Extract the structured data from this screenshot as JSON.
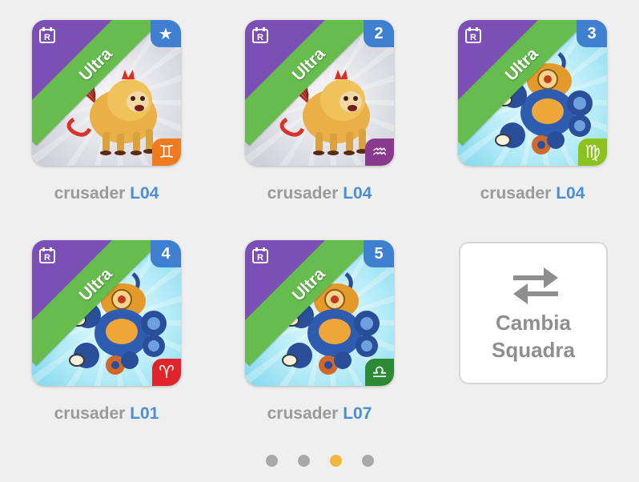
{
  "cards": [
    {
      "tier_label": "Ultra",
      "badge_top": "★",
      "badge_top_icon": "star-icon",
      "badge_bottom": "♊",
      "badge_bottom_icon": "gemini-sign-icon",
      "badge_bottom_color": "#f07a1e",
      "bg": "gray",
      "creature": "lion-monkey-creature",
      "name": "crusader",
      "level": "L04"
    },
    {
      "tier_label": "Ultra",
      "badge_top": "2",
      "badge_bottom": "♒",
      "badge_bottom_icon": "aquarius-sign-icon",
      "badge_bottom_color": "#8a3a8e",
      "bg": "gray",
      "creature": "lion-monkey-creature",
      "name": "crusader",
      "level": "L04"
    },
    {
      "tier_label": "Ultra",
      "badge_top": "3",
      "badge_bottom": "♍",
      "badge_bottom_icon": "virgo-sign-icon",
      "badge_bottom_color": "#8cc21e",
      "bg": "blue",
      "creature": "robot-creature",
      "name": "crusader",
      "level": "L04"
    },
    {
      "tier_label": "Ultra",
      "badge_top": "4",
      "badge_bottom": "♈",
      "badge_bottom_icon": "aries-sign-icon",
      "badge_bottom_color": "#e0252a",
      "bg": "blue",
      "creature": "robot-creature",
      "name": "crusader",
      "level": "L01"
    },
    {
      "tier_label": "Ultra",
      "badge_top": "5",
      "badge_bottom": "♎",
      "badge_bottom_icon": "libra-sign-icon",
      "badge_bottom_color": "#2d8a34",
      "bg": "blue",
      "creature": "robot-creature",
      "name": "crusader",
      "level": "L07"
    }
  ],
  "swap": {
    "line1": "Cambia",
    "line2": "Squadra",
    "icon": "swap-arrows-icon"
  },
  "pagination": {
    "count": 4,
    "active_index": 2,
    "active_color": "#f3b63b",
    "inactive_color": "#a8a8a8"
  },
  "colors": {
    "level_text": "#4a8fd6",
    "name_text": "#9a9a9a",
    "ribbon": "#66bc4c",
    "corner": "#7b4fb6",
    "number_badge": "#3f7fd0"
  }
}
